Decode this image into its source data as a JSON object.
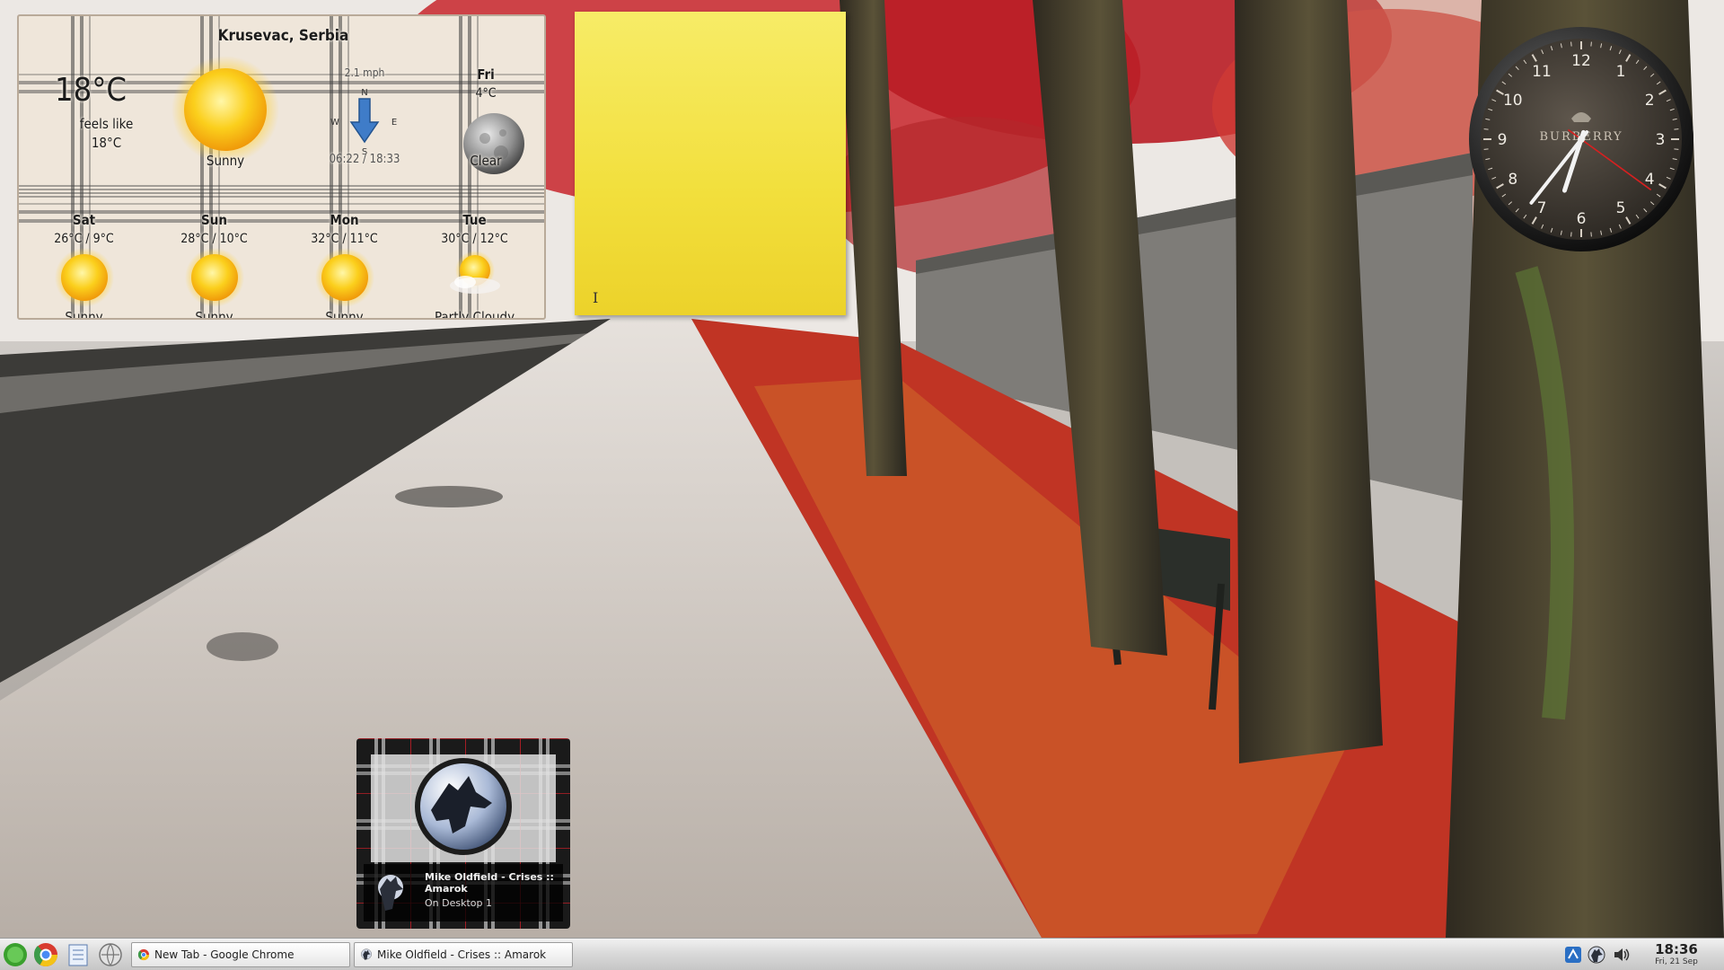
{
  "weather": {
    "city": "Krusevac, Serbia",
    "temperature": "18°C",
    "feels_like_label": "feels like",
    "feels_like_value": "18°C",
    "condition": "Sunny",
    "wind": "2.1 mph",
    "compass": {
      "n": "N",
      "s": "S",
      "e": "E",
      "w": "W"
    },
    "sunrise_sunset": "06:22 / 18:33",
    "today": {
      "day": "Fri",
      "temp": "4°C",
      "condition": "Clear",
      "icon": "moon-icon"
    },
    "forecast": [
      {
        "day": "Sat",
        "range": "26°C / 9°C",
        "condition": "Sunny",
        "icon": "sun-icon"
      },
      {
        "day": "Sun",
        "range": "28°C / 10°C",
        "condition": "Sunny",
        "icon": "sun-icon"
      },
      {
        "day": "Mon",
        "range": "32°C / 11°C",
        "condition": "Sunny",
        "icon": "sun-icon"
      },
      {
        "day": "Tue",
        "range": "30°C / 12°C",
        "condition": "Partly Cloudy",
        "icon": "partly-cloudy-icon"
      }
    ]
  },
  "sticky_note": {
    "text": "",
    "cursor_glyph": "I"
  },
  "clock": {
    "brand": "BURBERRY",
    "numerals": [
      "12",
      "1",
      "2",
      "3",
      "4",
      "5",
      "6",
      "7",
      "8",
      "9",
      "10",
      "11"
    ],
    "time": "18:36",
    "second_hand_seconds": 21
  },
  "amarok": {
    "track_title": "Mike Oldfield - Crises :: Amarok",
    "desktop": "On Desktop 1"
  },
  "taskbar": {
    "launchers": [
      "kde-menu-icon",
      "chrome-icon",
      "file-manager-icon",
      "network-icon"
    ],
    "tasks": [
      {
        "label": "New Tab - Google Chrome",
        "icon": "chrome-icon"
      },
      {
        "label": "Mike Oldfield - Crises  :: Amarok",
        "icon": "amarok-icon"
      }
    ],
    "tray": [
      "network-tray-icon",
      "amarok-tray-icon",
      "volume-icon"
    ],
    "time": "18:36",
    "date": "Fri, 21 Sep"
  },
  "colors": {
    "accent_red": "#c8242c",
    "sticky_yellow": "#f2df3c",
    "clock_face": "#3b352f",
    "taskbar": "#d8d8d8"
  }
}
